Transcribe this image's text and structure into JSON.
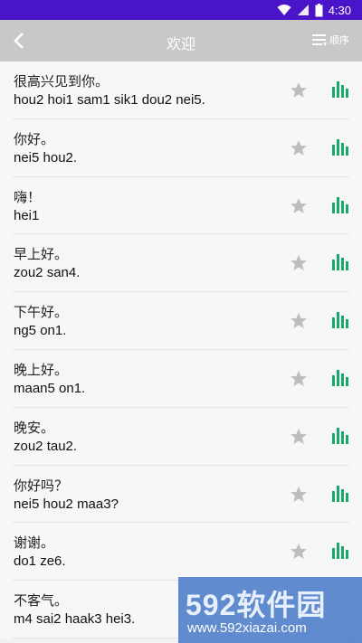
{
  "status": {
    "time": "4:30"
  },
  "toolbar": {
    "title": "欢迎",
    "order_label": "顺序"
  },
  "phrases": [
    {
      "cn": "很高兴见到你。",
      "py": "hou2 hoi1 sam1 sik1 dou2 nei5."
    },
    {
      "cn": "你好。",
      "py": "nei5 hou2."
    },
    {
      "cn": "嗨！",
      "py": "hei1"
    },
    {
      "cn": "早上好。",
      "py": "zou2 san4."
    },
    {
      "cn": "下午好。",
      "py": "ng5 on1."
    },
    {
      "cn": "晚上好。",
      "py": "maan5 on1."
    },
    {
      "cn": "晚安。",
      "py": "zou2 tau2."
    },
    {
      "cn": "你好吗？",
      "py": "nei5 hou2 maa3?"
    },
    {
      "cn": "谢谢。",
      "py": "do1 ze6."
    },
    {
      "cn": "不客气。",
      "py": "m4 sai2 haak3 hei3."
    }
  ],
  "icons": {
    "star": "star-icon",
    "play": "audio-bars-icon"
  },
  "colors": {
    "statusbar": "#4a14c8",
    "toolbar": "#c8c8c8",
    "bars": "#1aa86a",
    "star": "#bdbdbd"
  },
  "watermark": {
    "brand": "592软件园",
    "url": "www.592xiazai.com"
  }
}
